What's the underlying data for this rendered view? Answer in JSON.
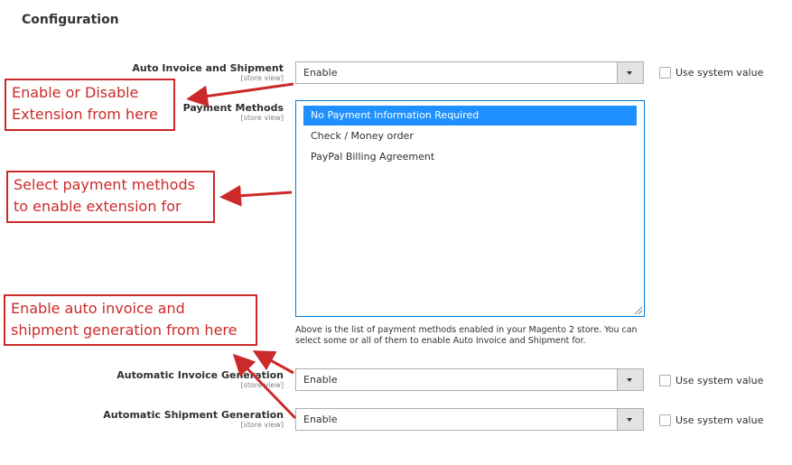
{
  "page": {
    "title": "Configuration"
  },
  "fields": {
    "auto_invoice_shipment": {
      "label": "Auto Invoice and Shipment",
      "scope": "[store view]",
      "value": "Enable",
      "use_system_value_label": "Use system value",
      "use_system_value_checked": false
    },
    "payment_methods": {
      "label": "Payment Methods",
      "scope": "[store view]",
      "options": [
        {
          "label": "No Payment Information Required",
          "selected": true
        },
        {
          "label": "Check / Money order",
          "selected": false
        },
        {
          "label": "PayPal Billing Agreement",
          "selected": false
        }
      ],
      "note": "Above is the list of payment methods enabled in your Magento 2 store. You can select some or all of them to enable Auto Invoice and Shipment for."
    },
    "automatic_invoice_generation": {
      "label": "Automatic Invoice Generation",
      "scope": "[store view]",
      "value": "Enable",
      "use_system_value_label": "Use system value",
      "use_system_value_checked": false
    },
    "automatic_shipment_generation": {
      "label": "Automatic Shipment Generation",
      "scope": "[store view]",
      "value": "Enable",
      "use_system_value_label": "Use system value",
      "use_system_value_checked": false
    }
  },
  "annotations": {
    "enable_disable": {
      "line1": "Enable or Disable",
      "line2": "Extension from here"
    },
    "payment_methods": {
      "line1": "Select payment methods",
      "line2": "to enable extension for"
    },
    "auto_generation": {
      "line1": "Enable auto invoice and",
      "line2": "shipment generation from here"
    },
    "color": "#cc2a2a"
  },
  "colors": {
    "selected_option_bg": "#1e90ff",
    "multiselect_border": "#007bdb",
    "select_border": "#adadad"
  }
}
